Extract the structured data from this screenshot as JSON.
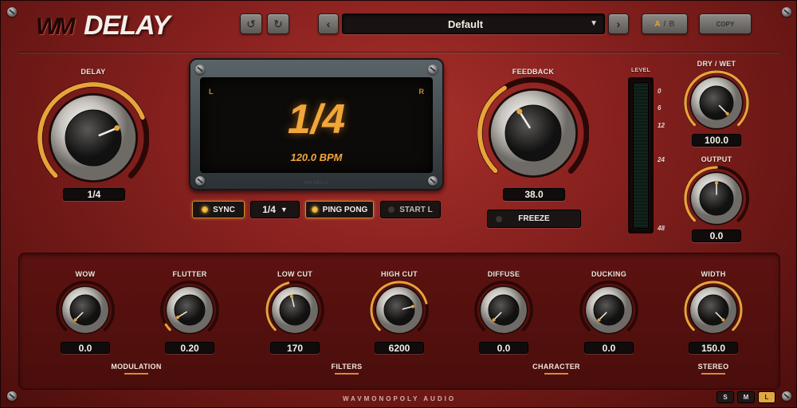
{
  "header": {
    "logo_mark": "WM",
    "title": "DELAY",
    "undo_icon": "undo-icon",
    "redo_icon": "redo-icon",
    "prev_icon": "chevron-left-icon",
    "next_icon": "chevron-right-icon",
    "preset": "Default",
    "ab_a": "A",
    "ab_sep": "/",
    "ab_b": "B",
    "copy_label": "COPY"
  },
  "delay": {
    "label": "DELAY",
    "value": "1/4",
    "norm": 0.75
  },
  "display": {
    "left": "L",
    "right": "R",
    "main": "1/4",
    "bpm": "120.0 BPM",
    "footer": "WM DELAY"
  },
  "controls": {
    "sync_label": "SYNC",
    "division": "1/4",
    "pingpong_label": "PING PONG",
    "start_label": "START L",
    "freeze_label": "FREEZE"
  },
  "feedback": {
    "label": "FEEDBACK",
    "value": "38.0",
    "norm": 0.38
  },
  "meter": {
    "label": "LEVEL",
    "ticks": [
      "0",
      "6",
      "12",
      "24",
      "48"
    ]
  },
  "drywet": {
    "label": "DRY / WET",
    "value": "100.0",
    "norm": 1.0
  },
  "output": {
    "label": "OUTPUT",
    "value": "0.0",
    "norm": 0.5
  },
  "lower": {
    "knobs": [
      {
        "label": "WOW",
        "value": "0.0",
        "norm": 0.0
      },
      {
        "label": "FLUTTER",
        "value": "0.20",
        "norm": 0.05
      },
      {
        "label": "LOW CUT",
        "value": "170",
        "norm": 0.45
      },
      {
        "label": "HIGH CUT",
        "value": "6200",
        "norm": 0.78
      },
      {
        "label": "DIFFUSE",
        "value": "0.0",
        "norm": 0.0
      },
      {
        "label": "DUCKING",
        "value": "0.0",
        "norm": 0.0
      },
      {
        "label": "WIDTH",
        "value": "150.0",
        "norm": 1.0
      }
    ],
    "groups": [
      "MODULATION",
      "FILTERS",
      "CHARACTER",
      "STEREO"
    ]
  },
  "footer": {
    "brand": "WAVMONOPOLY AUDIO",
    "size_s": "S",
    "size_m": "M",
    "size_l": "L"
  },
  "colors": {
    "accent": "#e8a33a",
    "panel": "#8a2220"
  }
}
